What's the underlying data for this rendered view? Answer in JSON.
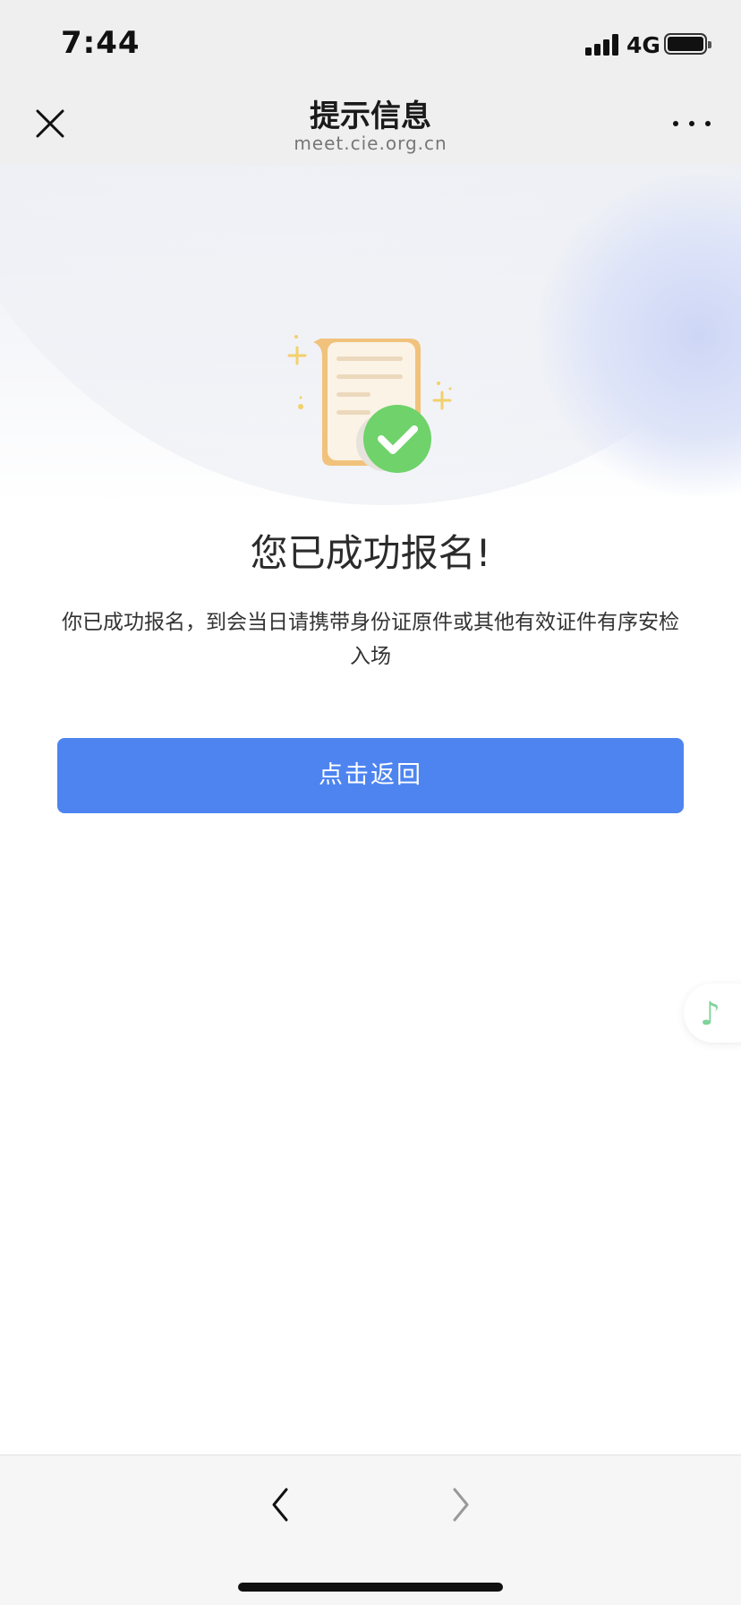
{
  "status_bar": {
    "time": "7:44",
    "network": "4G",
    "icons": [
      "signal-icon",
      "battery-icon"
    ]
  },
  "nav_bar": {
    "title": "提示信息",
    "subtitle": "meet.cie.org.cn",
    "icons": [
      "close-icon",
      "more-icon"
    ]
  },
  "main": {
    "illustration_icon": "document-check-icon",
    "title": "您已成功报名!",
    "description": "你已成功报名，到会当日请携带身份证原件或其他有效证件有序安检入场",
    "button_label": "点击返回",
    "button_color": "#4d84f0"
  },
  "floating": {
    "icon": "music-note-icon",
    "glyph": "♪"
  },
  "bottom_bar": {
    "icons": [
      "back-arrow-icon",
      "forward-arrow-icon"
    ]
  }
}
